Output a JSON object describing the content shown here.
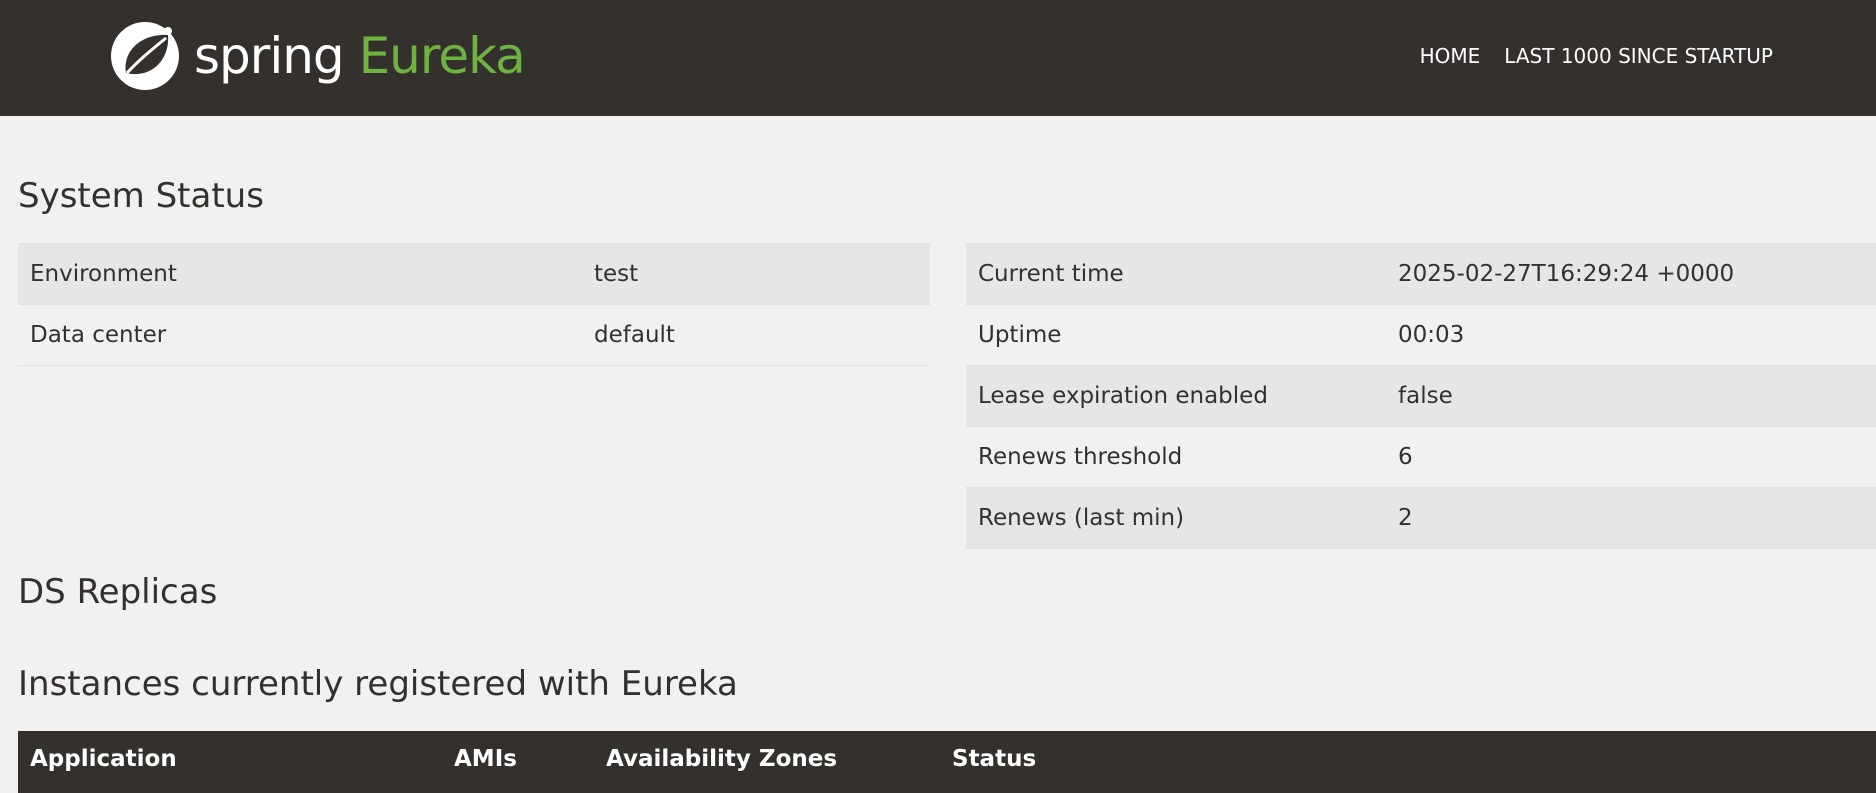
{
  "brand": {
    "spring": "spring",
    "eureka": "Eureka"
  },
  "nav": {
    "home": "HOME",
    "last1000": "LAST 1000 SINCE STARTUP"
  },
  "system_status": {
    "title": "System Status",
    "left": [
      {
        "label": "Environment",
        "value": "test"
      },
      {
        "label": "Data center",
        "value": "default"
      }
    ],
    "right": [
      {
        "label": "Current time",
        "value": "2025-02-27T16:29:24 +0000"
      },
      {
        "label": "Uptime",
        "value": "00:03"
      },
      {
        "label": "Lease expiration enabled",
        "value": "false"
      },
      {
        "label": "Renews threshold",
        "value": "6"
      },
      {
        "label": "Renews (last min)",
        "value": "2"
      }
    ]
  },
  "ds_replicas": {
    "title": "DS Replicas"
  },
  "instances": {
    "title": "Instances currently registered with Eureka",
    "columns": [
      "Application",
      "AMIs",
      "Availability Zones",
      "Status"
    ]
  },
  "colors": {
    "header_bg": "#34302d",
    "brand_green": "#6db33f",
    "page_bg": "#f1f1f1",
    "row_shade": "#e6e6e6"
  }
}
